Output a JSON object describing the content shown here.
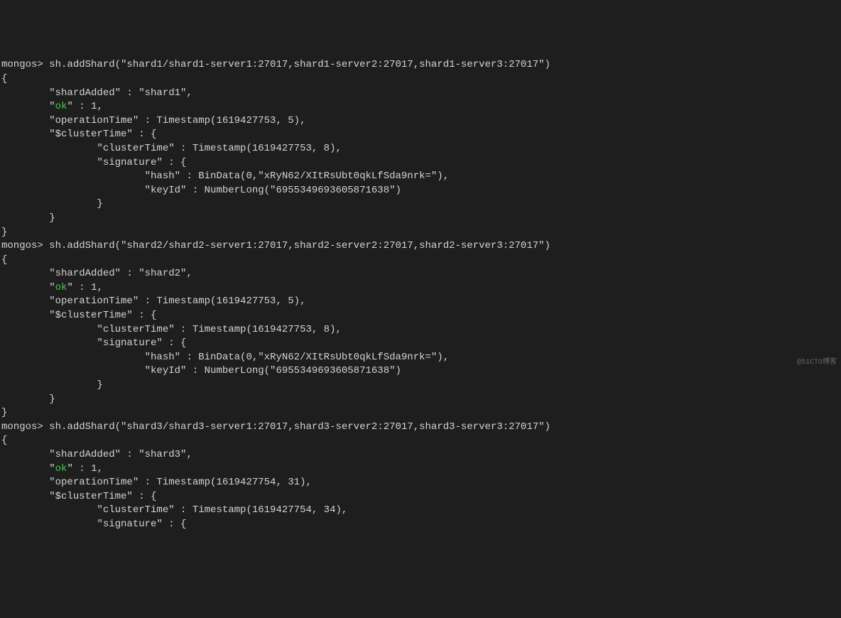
{
  "watermark": "@51CTO博客",
  "lines": [
    {
      "type": "plain",
      "text": "mongos> sh.addShard(\"shard1/shard1-server1:27017,shard1-server2:27017,shard1-server3:27017\")"
    },
    {
      "type": "plain",
      "text": "{"
    },
    {
      "type": "plain",
      "text": "        \"shardAdded\" : \"shard1\","
    },
    {
      "type": "ok",
      "prefix": "        \"",
      "ok": "ok",
      "suffix": "\" : 1,"
    },
    {
      "type": "plain",
      "text": "        \"operationTime\" : Timestamp(1619427753, 5),"
    },
    {
      "type": "plain",
      "text": "        \"$clusterTime\" : {"
    },
    {
      "type": "plain",
      "text": "                \"clusterTime\" : Timestamp(1619427753, 8),"
    },
    {
      "type": "plain",
      "text": "                \"signature\" : {"
    },
    {
      "type": "plain",
      "text": "                        \"hash\" : BinData(0,\"xRyN62/XItRsUbt0qkLfSda9nrk=\"),"
    },
    {
      "type": "plain",
      "text": "                        \"keyId\" : NumberLong(\"6955349693605871638\")"
    },
    {
      "type": "plain",
      "text": "                }"
    },
    {
      "type": "plain",
      "text": "        }"
    },
    {
      "type": "plain",
      "text": "}"
    },
    {
      "type": "plain",
      "text": "mongos> sh.addShard(\"shard2/shard2-server1:27017,shard2-server2:27017,shard2-server3:27017\")"
    },
    {
      "type": "plain",
      "text": "{"
    },
    {
      "type": "plain",
      "text": "        \"shardAdded\" : \"shard2\","
    },
    {
      "type": "ok",
      "prefix": "        \"",
      "ok": "ok",
      "suffix": "\" : 1,"
    },
    {
      "type": "plain",
      "text": "        \"operationTime\" : Timestamp(1619427753, 5),"
    },
    {
      "type": "plain",
      "text": "        \"$clusterTime\" : {"
    },
    {
      "type": "plain",
      "text": "                \"clusterTime\" : Timestamp(1619427753, 8),"
    },
    {
      "type": "plain",
      "text": "                \"signature\" : {"
    },
    {
      "type": "plain",
      "text": "                        \"hash\" : BinData(0,\"xRyN62/XItRsUbt0qkLfSda9nrk=\"),"
    },
    {
      "type": "plain",
      "text": "                        \"keyId\" : NumberLong(\"6955349693605871638\")"
    },
    {
      "type": "plain",
      "text": "                }"
    },
    {
      "type": "plain",
      "text": "        }"
    },
    {
      "type": "plain",
      "text": "}"
    },
    {
      "type": "plain",
      "text": "mongos> sh.addShard(\"shard3/shard3-server1:27017,shard3-server2:27017,shard3-server3:27017\")"
    },
    {
      "type": "plain",
      "text": "{"
    },
    {
      "type": "plain",
      "text": "        \"shardAdded\" : \"shard3\","
    },
    {
      "type": "ok",
      "prefix": "        \"",
      "ok": "ok",
      "suffix": "\" : 1,"
    },
    {
      "type": "plain",
      "text": "        \"operationTime\" : Timestamp(1619427754, 31),"
    },
    {
      "type": "plain",
      "text": "        \"$clusterTime\" : {"
    },
    {
      "type": "plain",
      "text": "                \"clusterTime\" : Timestamp(1619427754, 34),"
    },
    {
      "type": "plain",
      "text": "                \"signature\" : {"
    }
  ]
}
